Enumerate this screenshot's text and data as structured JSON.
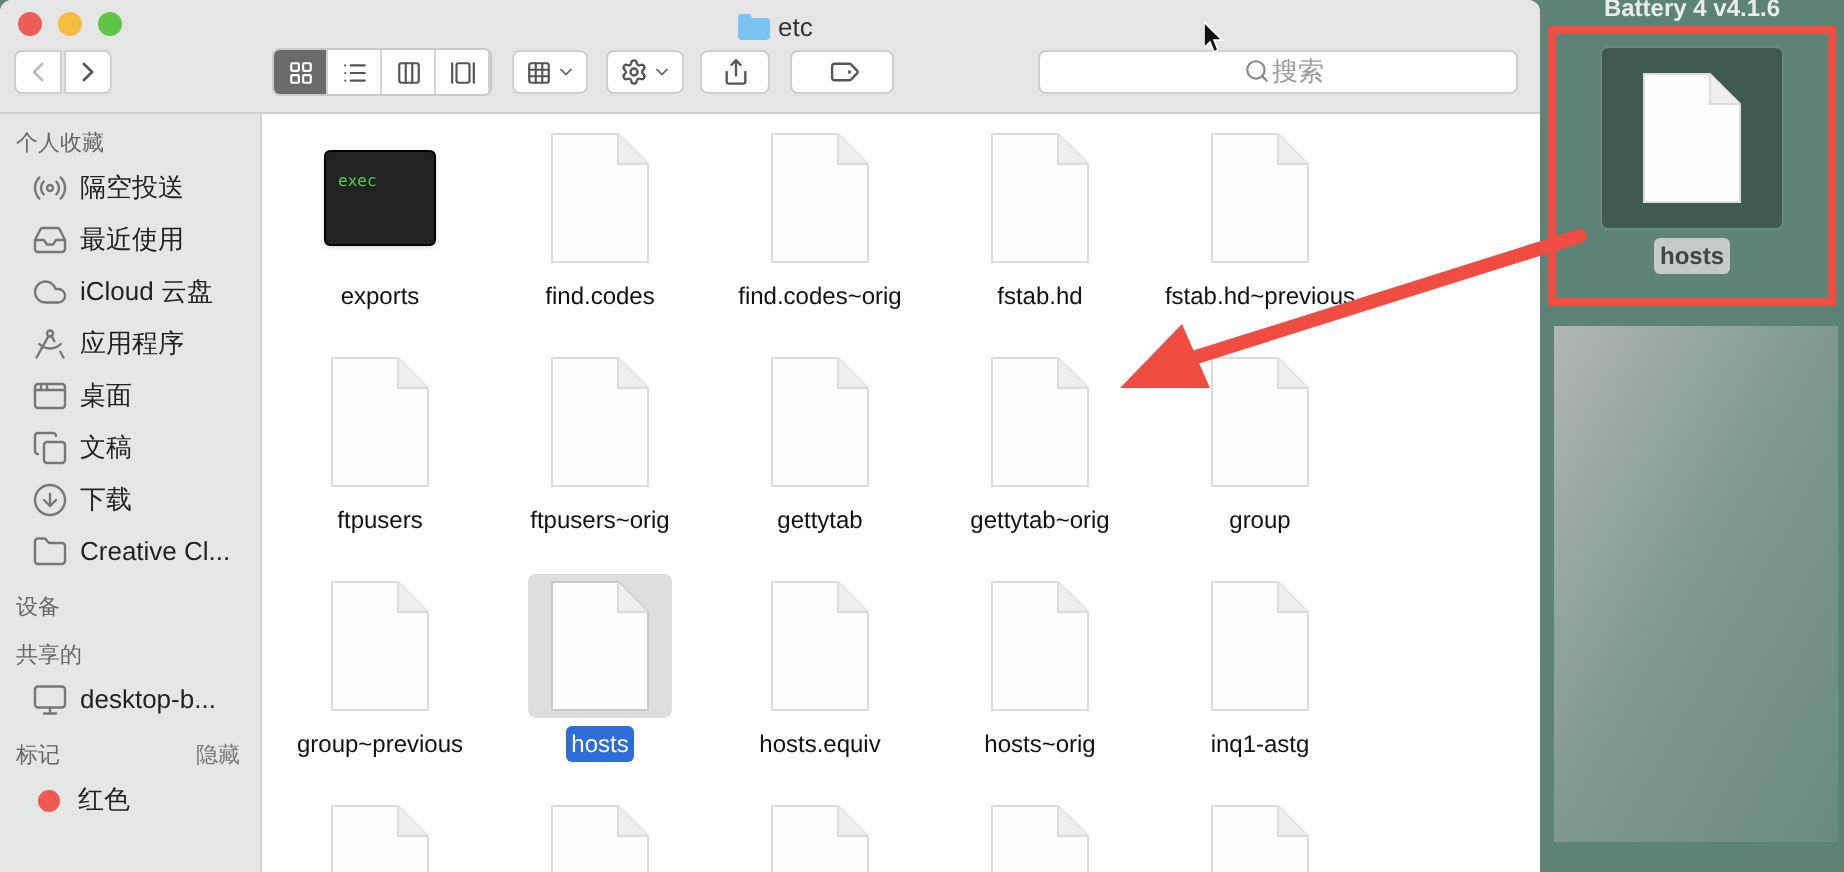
{
  "window": {
    "title": "etc"
  },
  "toolbar": {
    "view_modes": [
      {
        "kind": "icons",
        "selected": true
      },
      {
        "kind": "list",
        "selected": false
      },
      {
        "kind": "columns",
        "selected": false
      },
      {
        "kind": "gallery",
        "selected": false
      }
    ],
    "search": {
      "placeholder": "搜索"
    }
  },
  "sidebar": {
    "sections": [
      {
        "heading": "个人收藏",
        "items": [
          {
            "kind": "airdrop",
            "label": "隔空投送"
          },
          {
            "kind": "recents",
            "label": "最近使用"
          },
          {
            "kind": "icloud",
            "label": "iCloud 云盘"
          },
          {
            "kind": "apps",
            "label": "应用程序"
          },
          {
            "kind": "desktop",
            "label": "桌面"
          },
          {
            "kind": "documents",
            "label": "文稿"
          },
          {
            "kind": "downloads",
            "label": "下载"
          },
          {
            "kind": "folder",
            "label": "Creative Cl..."
          }
        ]
      },
      {
        "heading": "设备"
      },
      {
        "heading": "共享的",
        "items": [
          {
            "kind": "computer",
            "label": "desktop-b..."
          }
        ]
      },
      {
        "heading": "标记",
        "action": "隐藏",
        "items": [
          {
            "kind": "tag",
            "label": "红色",
            "color": "#ee5a4f"
          }
        ]
      }
    ]
  },
  "files": [
    {
      "kind": "exec",
      "name": "exports",
      "badge": "exec",
      "selected": false
    },
    {
      "kind": "document",
      "name": "find.codes",
      "selected": false
    },
    {
      "kind": "document",
      "name": "find.codes~orig",
      "selected": false
    },
    {
      "kind": "document",
      "name": "fstab.hd",
      "selected": false
    },
    {
      "kind": "document",
      "name": "fstab.hd~previous",
      "selected": false
    },
    {
      "kind": "document",
      "name": "ftpusers",
      "selected": false
    },
    {
      "kind": "document",
      "name": "ftpusers~orig",
      "selected": false
    },
    {
      "kind": "document",
      "name": "gettytab",
      "selected": false
    },
    {
      "kind": "document",
      "name": "gettytab~orig",
      "selected": false
    },
    {
      "kind": "document",
      "name": "group",
      "selected": false
    },
    {
      "kind": "document",
      "name": "group~previous",
      "selected": false
    },
    {
      "kind": "document",
      "name": "hosts",
      "selected": true
    },
    {
      "kind": "document",
      "name": "hosts.equiv",
      "selected": false
    },
    {
      "kind": "document",
      "name": "hosts~orig",
      "selected": false
    },
    {
      "kind": "document",
      "name": "inq1-astg",
      "selected": false
    },
    {
      "kind": "document",
      "selected": false
    },
    {
      "kind": "document",
      "selected": false
    },
    {
      "kind": "document",
      "selected": false
    },
    {
      "kind": "document",
      "selected": false
    },
    {
      "kind": "document",
      "selected": false
    }
  ],
  "desktop": {
    "label": "Battery 4 v4.1.6",
    "icon": {
      "name": "hosts",
      "selected": true
    }
  }
}
